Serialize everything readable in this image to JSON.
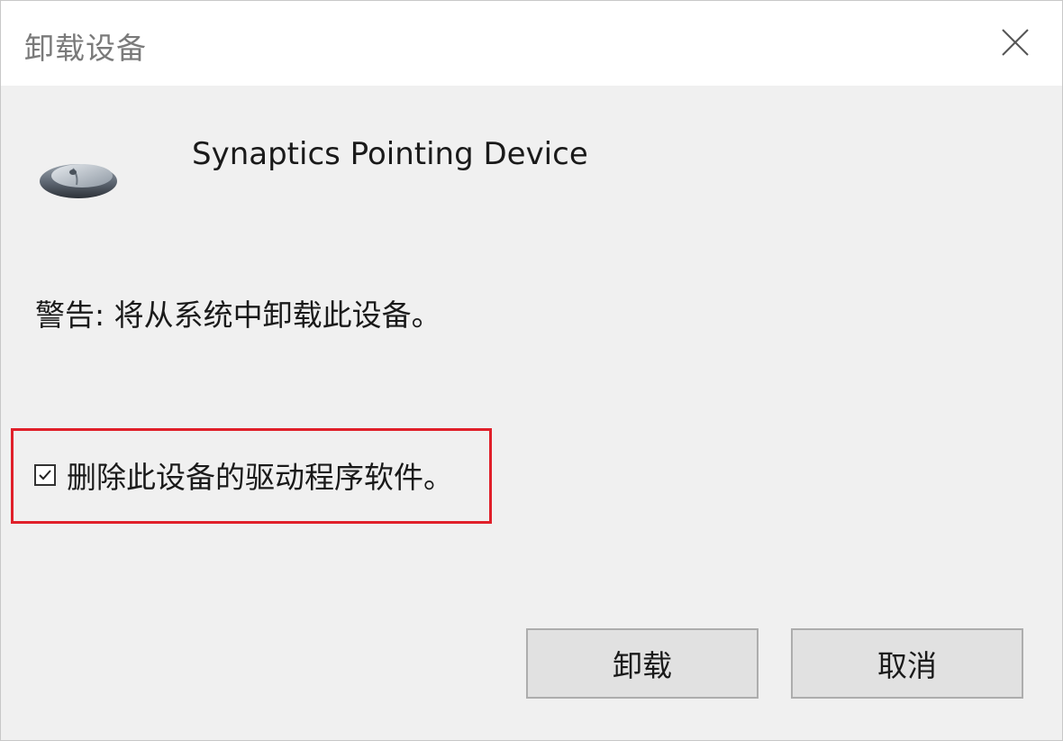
{
  "dialog": {
    "title": "卸载设备",
    "close_icon": "close-icon"
  },
  "device": {
    "icon": "mouse-icon",
    "name": "Synaptics Pointing Device"
  },
  "warning": {
    "text": "警告: 将从系统中卸载此设备。"
  },
  "option": {
    "checked": true,
    "label": "删除此设备的驱动程序软件。",
    "highlight_color": "#e0202a"
  },
  "buttons": {
    "uninstall_label": "卸载",
    "cancel_label": "取消"
  }
}
